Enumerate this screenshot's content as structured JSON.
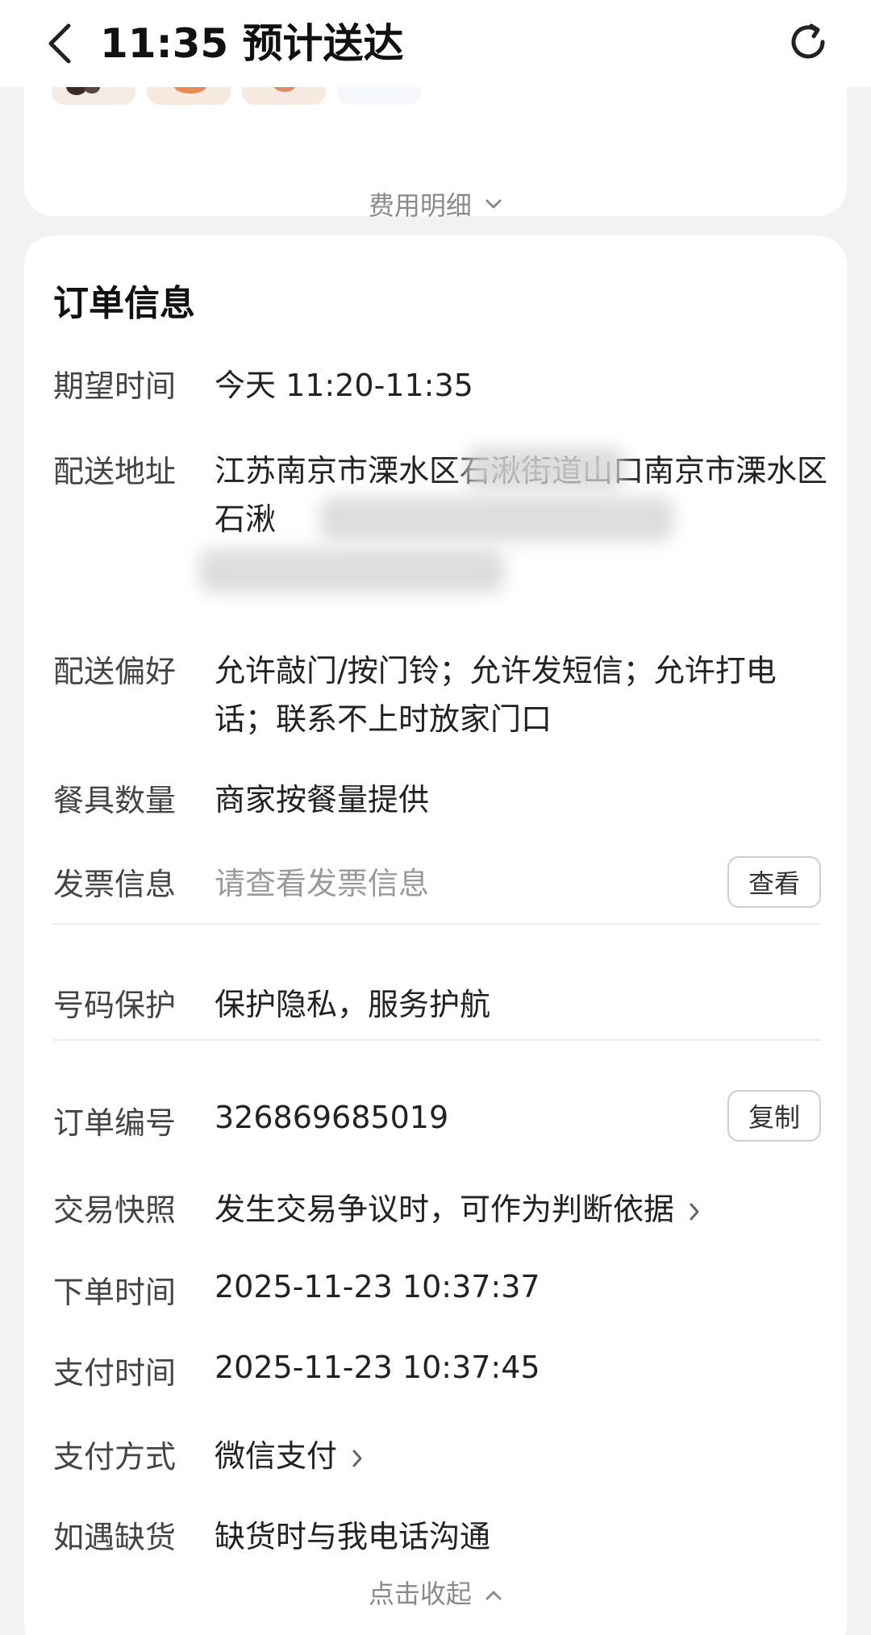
{
  "header": {
    "title": "11:35 预计送达",
    "back_icon": "chevron-left-icon",
    "refresh_icon": "refresh-icon"
  },
  "goods_card": {
    "fee_detail_label": "费用明细"
  },
  "order_info": {
    "title": "订单信息",
    "rows": {
      "expected_time": {
        "label": "期望时间",
        "value": "今天 11:20-11:35"
      },
      "address": {
        "label": "配送地址",
        "value": "江苏南京市溧水区石湫街道山口南京市溧水区石湫"
      },
      "preference": {
        "label": "配送偏好",
        "value": "允许敲门/按门铃；允许发短信；允许打电话；联系不上时放家门口"
      },
      "tableware": {
        "label": "餐具数量",
        "value": "商家按餐量提供"
      },
      "invoice": {
        "label": "发票信息",
        "value": "请查看发票信息",
        "button": "查看"
      },
      "number_protect": {
        "label": "号码保护",
        "value": "保护隐私，服务护航"
      },
      "order_no": {
        "label": "订单编号",
        "value": "326869685019",
        "button": "复制"
      },
      "snapshot": {
        "label": "交易快照",
        "value": "发生交易争议时，可作为判断依据"
      },
      "order_time": {
        "label": "下单时间",
        "value": "2025-11-23 10:37:37"
      },
      "pay_time": {
        "label": "支付时间",
        "value": "2025-11-23 10:37:45"
      },
      "pay_method": {
        "label": "支付方式",
        "value": "微信支付"
      },
      "out_of_stock": {
        "label": "如遇缺货",
        "value": "缺货时与我电话沟通"
      }
    },
    "collapse_label": "点击收起"
  }
}
